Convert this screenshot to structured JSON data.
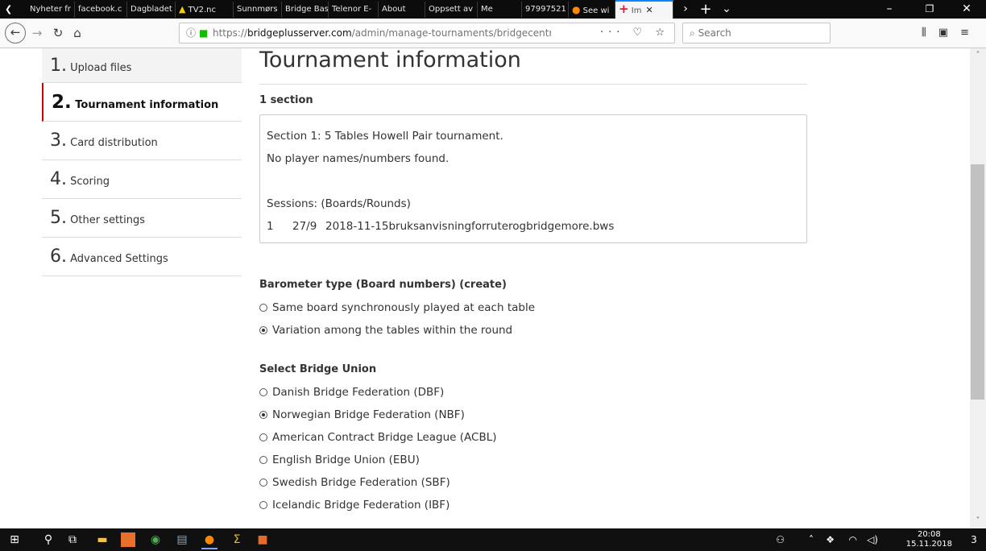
{
  "browser": {
    "tabs": [
      {
        "label": "Nyheter fr"
      },
      {
        "label": "facebook.c"
      },
      {
        "label": "Dagbladet"
      },
      {
        "label": "TV2.nc"
      },
      {
        "label": "Sunnmørs"
      },
      {
        "label": "Bridge Bas"
      },
      {
        "label": "Telenor E-"
      },
      {
        "label": "About"
      },
      {
        "label": "Oppsett av"
      },
      {
        "label": "Me"
      },
      {
        "label": "97997521"
      },
      {
        "label": "See wi"
      },
      {
        "label": "Im"
      }
    ],
    "url_host": "bridgeplusserver.com",
    "url_prefix": "https://",
    "url_path": "/admin/manage-tournaments/bridgecentralen-imp",
    "search_placeholder": "Search",
    "url_actions": "··· ♡ ☆"
  },
  "sidebar": {
    "steps": [
      {
        "num": "1.",
        "label": "Upload files"
      },
      {
        "num": "2.",
        "label": "Tournament information"
      },
      {
        "num": "3.",
        "label": "Card distribution"
      },
      {
        "num": "4.",
        "label": "Scoring"
      },
      {
        "num": "5.",
        "label": "Other settings"
      },
      {
        "num": "6.",
        "label": "Advanced Settings"
      }
    ],
    "active_index": 1
  },
  "main": {
    "title": "Tournament information",
    "section_count": "1 section",
    "info": {
      "line1": "Section 1: 5 Tables Howell Pair tournament.",
      "line2": "No player names/numbers found.",
      "sessions_header": "Sessions: (Boards/Rounds)",
      "session": {
        "no": "1",
        "boards_rounds": "27/9",
        "file": "2018-11-15bruksanvisningforruterogbridgemore.bws"
      }
    },
    "barometer": {
      "label": "Barometer type (Board numbers) (create)",
      "options": [
        {
          "label": "Same board synchronously played at each table",
          "selected": false
        },
        {
          "label": "Variation among the tables within the round",
          "selected": true
        }
      ]
    },
    "union": {
      "label": "Select Bridge Union",
      "options": [
        {
          "label": "Danish Bridge Federation (DBF)",
          "selected": false
        },
        {
          "label": "Norwegian Bridge Federation (NBF)",
          "selected": true
        },
        {
          "label": "American Contract Bridge League (ACBL)",
          "selected": false
        },
        {
          "label": "English Bridge Union (EBU)",
          "selected": false
        },
        {
          "label": "Swedish Bridge Federation (SBF)",
          "selected": false
        },
        {
          "label": "Icelandic Bridge Federation (IBF)",
          "selected": false
        }
      ]
    }
  },
  "taskbar": {
    "time": "20:08",
    "date": "15.11.2018",
    "notifications": "3"
  }
}
